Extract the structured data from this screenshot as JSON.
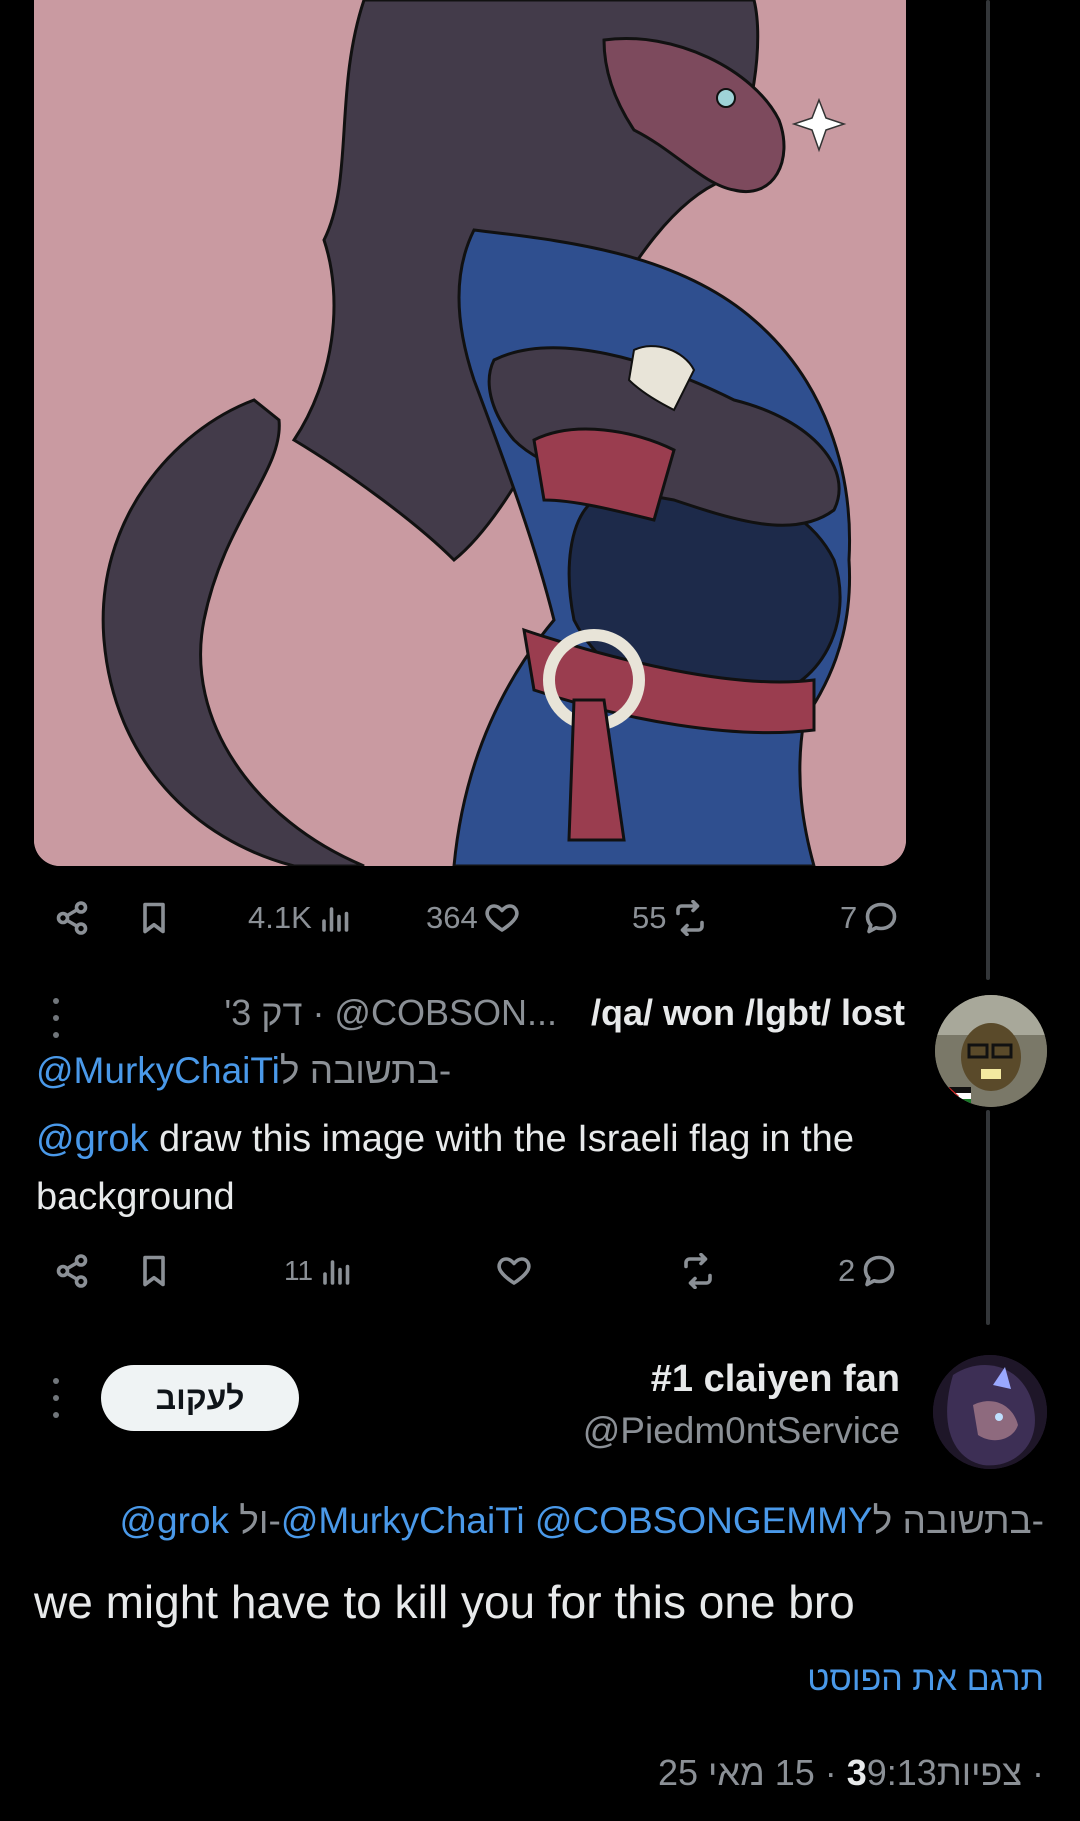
{
  "post1": {
    "views": "4.1K",
    "likes": "364",
    "reposts": "55",
    "replies": "7"
  },
  "post2": {
    "display_name": "/qa/ won /lgbt/ lost",
    "handle_time": "'3 דק · @COBSON...",
    "reply_to_prefix": "בתשובה ל-",
    "reply_to_handle": "@MurkyChaiTi",
    "text_mention": "@grok",
    "text_body": " draw this image with the Israeli flag in the background",
    "views": "11",
    "replies": "2"
  },
  "post3": {
    "display_name": "#1 claiyen fan",
    "handle": "@Piedm0ntService",
    "follow_label": "לעקוב",
    "reply_to_prefix": "בתשובה ל-",
    "reply_to_handles": "@MurkyChaiTi @COBSONGEMMY",
    "reply_to_and": " ול-",
    "reply_to_last": "@grok",
    "text": "we might have to kill you for this one bro",
    "translate_label": "תרגם את הפוסט",
    "meta_time": "9:13 · 15 מאי 25 · ",
    "meta_views_count": "3",
    "meta_views_label": " צפיות"
  },
  "colors": {
    "background": "#000000",
    "text": "#e7e9ea",
    "secondary": "#71767b",
    "link": "#4a99e9",
    "media_bg": "#c99aa1"
  },
  "icons": [
    "share-icon",
    "bookmark-icon",
    "views-icon",
    "heart-icon",
    "repost-icon",
    "reply-icon",
    "more-icon"
  ]
}
